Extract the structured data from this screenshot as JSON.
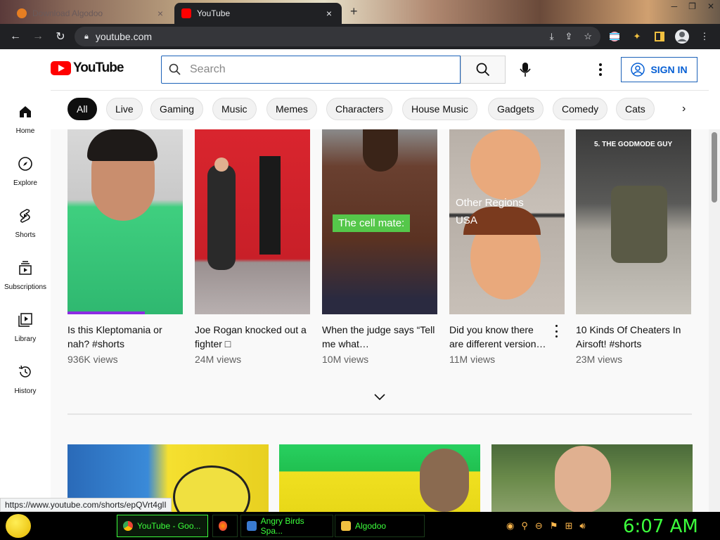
{
  "browser": {
    "tabs": [
      {
        "title": "Download Algodoo",
        "active": false
      },
      {
        "title": "YouTube",
        "active": true
      }
    ],
    "url": "youtube.com",
    "status_url": "https://www.youtube.com/shorts/epQVrt4glI"
  },
  "masthead": {
    "logo_text": "YouTube",
    "search_placeholder": "Search",
    "signin_label": "SIGN IN"
  },
  "sidebar": {
    "items": [
      {
        "label": "Home",
        "icon": "home-icon"
      },
      {
        "label": "Explore",
        "icon": "compass-icon"
      },
      {
        "label": "Shorts",
        "icon": "shorts-icon"
      },
      {
        "label": "Subscriptions",
        "icon": "subscriptions-icon"
      },
      {
        "label": "Library",
        "icon": "library-icon"
      },
      {
        "label": "History",
        "icon": "history-icon"
      }
    ]
  },
  "chips": [
    "All",
    "Live",
    "Gaming",
    "Music",
    "Memes",
    "Characters",
    "House Music",
    "Gadgets",
    "Comedy",
    "Cats"
  ],
  "shorts": [
    {
      "title": "Is this Kleptomania or nah? #shorts",
      "views": "936K views"
    },
    {
      "title": "Joe Rogan knocked out a fighter □",
      "views": "24M views"
    },
    {
      "title": "When the judge says “Tell me what…",
      "views": "10M views",
      "overlay": "The cell mate:"
    },
    {
      "title": "Did you know there are different version…",
      "views": "11M views",
      "overlay_top": "Other Regions",
      "overlay_bottom": "USA"
    },
    {
      "title": "10 Kinds Of Cheaters In Airsoft! #shorts",
      "views": "23M views",
      "overlay": "5. THE GODMODE GUY"
    }
  ],
  "taskbar": {
    "items": [
      {
        "label": "YouTube - Goo...",
        "active": true
      },
      {
        "label": "",
        "active": false
      },
      {
        "label": "Angry Birds Spa...",
        "active": false
      },
      {
        "label": "Algodoo",
        "active": false
      }
    ],
    "clock": "6:07 AM"
  },
  "colors": {
    "yt_red": "#ff0000",
    "link_blue": "#065fd4",
    "taskbar_green": "#3cff3c"
  }
}
